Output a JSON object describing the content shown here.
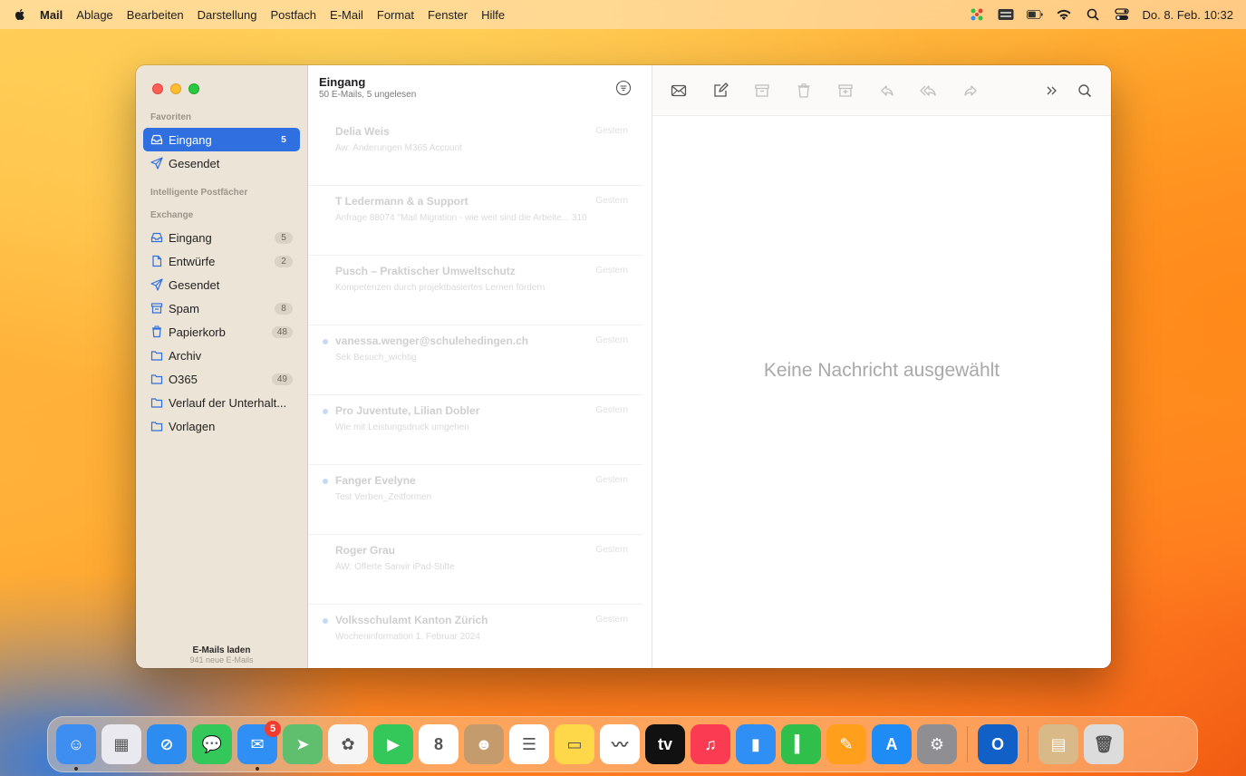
{
  "menubar": {
    "app_name": "Mail",
    "menus": [
      "Ablage",
      "Bearbeiten",
      "Darstellung",
      "Postfach",
      "E-Mail",
      "Format",
      "Fenster",
      "Hilfe"
    ],
    "clock": "Do. 8. Feb. 10:32",
    "status_icons": [
      "pinwheel-icon",
      "keyboard-icon",
      "battery-icon",
      "wifi-icon",
      "spotlight-icon",
      "control-center-icon"
    ]
  },
  "sidebar": {
    "favorites_label": "Favoriten",
    "favorites": [
      {
        "label": "Eingang",
        "count": "5",
        "icon": "inbox-icon",
        "active": true
      },
      {
        "label": "Gesendet",
        "count": "",
        "icon": "sent-icon"
      }
    ],
    "smart_label": "Intelligente Postfächer",
    "account_label": "Exchange",
    "account_items": [
      {
        "label": "Eingang",
        "count": "5",
        "icon": "inbox-icon"
      },
      {
        "label": "Entwürfe",
        "count": "2",
        "icon": "drafts-icon"
      },
      {
        "label": "Gesendet",
        "count": "",
        "icon": "sent-icon"
      },
      {
        "label": "Spam",
        "count": "8",
        "icon": "junk-icon"
      },
      {
        "label": "Papierkorb",
        "count": "48",
        "icon": "trash-icon"
      },
      {
        "label": "Archiv",
        "count": "",
        "icon": "folder-icon"
      },
      {
        "label": "O365",
        "count": "49",
        "icon": "folder-icon"
      },
      {
        "label": "Verlauf der Unterhalt...",
        "count": "",
        "icon": "folder-icon"
      },
      {
        "label": "Vorlagen",
        "count": "",
        "icon": "folder-icon"
      }
    ],
    "footer_title": "E-Mails laden",
    "footer_sub": "941 neue E-Mails"
  },
  "list": {
    "title": "Eingang",
    "subtitle": "50 E-Mails, 5 ungelesen",
    "messages": [
      {
        "from": "Delia Weis",
        "date": "Gestern",
        "subject": "Aw: Änderungen M365 Account",
        "unread": false
      },
      {
        "from": "T Ledermann & a Support",
        "date": "Gestern",
        "subject": "Anfrage 88074 \"Mail Migration - wie weit sind die Arbeite... 310",
        "unread": false
      },
      {
        "from": "Pusch – Praktischer Umweltschutz",
        "date": "Gestern",
        "subject": "Kompetenzen durch projektbasiertes Lernen fördern",
        "unread": false
      },
      {
        "from": "vanessa.wenger@schulehedingen.ch",
        "date": "Gestern",
        "subject": "Sek Besuch_wichtig",
        "unread": true
      },
      {
        "from": "Pro Juventute, Lilian Dobler",
        "date": "Gestern",
        "subject": "Wie mit Leistungsdruck umgehen",
        "unread": true
      },
      {
        "from": "Fanger Evelyne",
        "date": "Gestern",
        "subject": "Test Verben_Zeitformen",
        "unread": true
      },
      {
        "from": "Roger Grau",
        "date": "Gestern",
        "subject": "AW: Offerte Sanvir iPad-Stifte",
        "unread": false
      },
      {
        "from": "Volksschulamt Kanton Zürich",
        "date": "Gestern",
        "subject": "Wocheninformation 1. Februar 2024",
        "unread": true
      }
    ]
  },
  "reader": {
    "empty_message": "Keine Nachricht ausgewählt"
  },
  "dock": {
    "apps": [
      {
        "name": "finder",
        "color": "#3d8ef0",
        "glyph": "☺"
      },
      {
        "name": "launchpad",
        "color": "#e9e9ef",
        "glyph": "▦"
      },
      {
        "name": "safari",
        "color": "#2d8cf0",
        "glyph": "⊘"
      },
      {
        "name": "messages",
        "color": "#34c759",
        "glyph": "💬"
      },
      {
        "name": "mail",
        "color": "#2f8ff5",
        "glyph": "✉",
        "badge": "5"
      },
      {
        "name": "maps",
        "color": "#5fbf6f",
        "glyph": "➤"
      },
      {
        "name": "photos",
        "color": "#f5f5f5",
        "glyph": "✿"
      },
      {
        "name": "facetime",
        "color": "#34c759",
        "glyph": "▶"
      },
      {
        "name": "calendar",
        "color": "#ffffff",
        "glyph": "8"
      },
      {
        "name": "contacts",
        "color": "#c39b6d",
        "glyph": "☻"
      },
      {
        "name": "reminders",
        "color": "#ffffff",
        "glyph": "☰"
      },
      {
        "name": "notes",
        "color": "#ffd84a",
        "glyph": "▭"
      },
      {
        "name": "freeform",
        "color": "#ffffff",
        "glyph": "〰"
      },
      {
        "name": "appletv",
        "color": "#111111",
        "glyph": "tv"
      },
      {
        "name": "music",
        "color": "#fa3b52",
        "glyph": "♫"
      },
      {
        "name": "keynote",
        "color": "#2f8ff5",
        "glyph": "▮"
      },
      {
        "name": "numbers",
        "color": "#2fbf4a",
        "glyph": "▍"
      },
      {
        "name": "pages",
        "color": "#ff9f1c",
        "glyph": "✎"
      },
      {
        "name": "appstore",
        "color": "#1f8cf5",
        "glyph": "A"
      },
      {
        "name": "system-settings",
        "color": "#8e8e93",
        "glyph": "⚙"
      },
      {
        "name": "outlook",
        "color": "#1060c8",
        "glyph": "O"
      },
      {
        "name": "downloads",
        "color": "#d9b987",
        "glyph": "▤"
      },
      {
        "name": "trash",
        "color": "#dcdcdc",
        "glyph": "🗑"
      }
    ]
  }
}
